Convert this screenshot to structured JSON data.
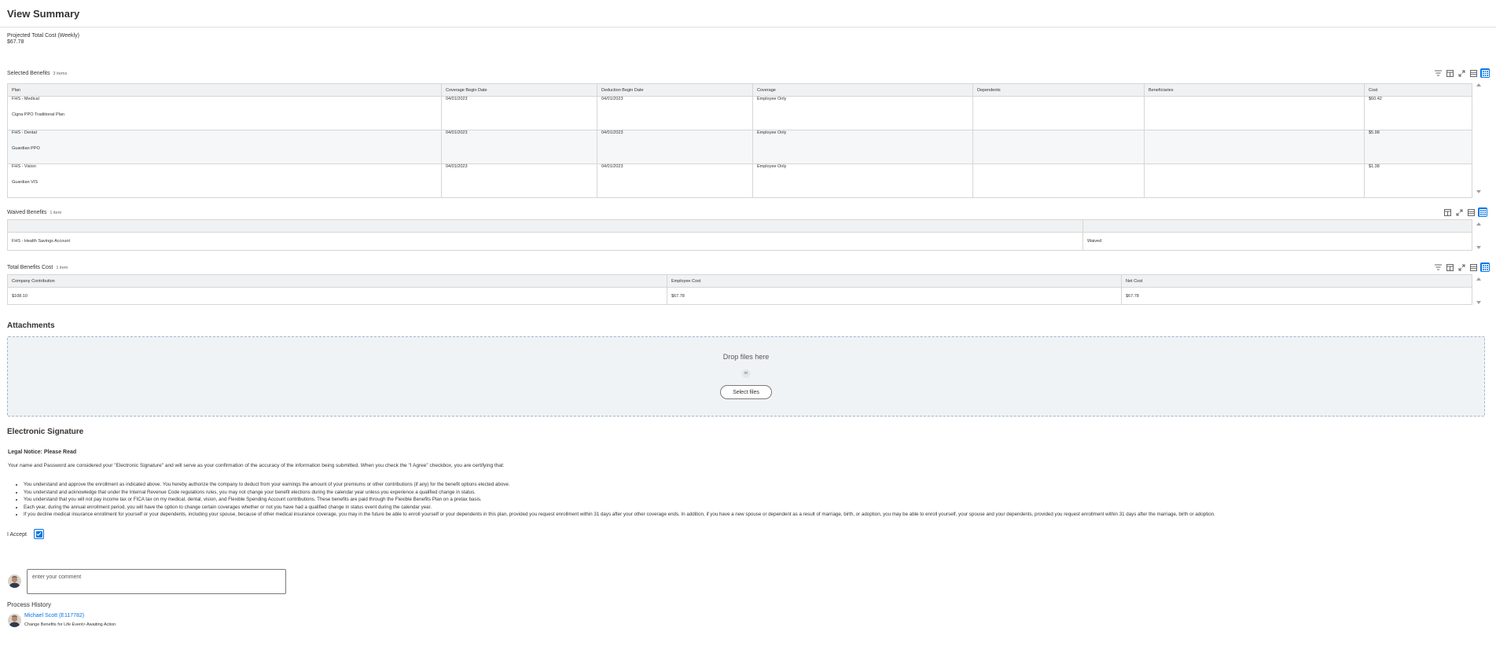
{
  "page": {
    "title": "View Summary"
  },
  "projected": {
    "label": "Projected Total Cost (Weekly)",
    "value": "$67.78"
  },
  "selected_benefits": {
    "title": "Selected Benefits",
    "count": "3 items",
    "columns": [
      "Plan",
      "Coverage Begin Date",
      "Deduction Begin Date",
      "Coverage",
      "Dependents",
      "Beneficiaries",
      "Cost"
    ],
    "rows": [
      {
        "plan": "FHS - Medical",
        "plan_detail": "Cigna PPO Traditional Plan",
        "coverage_begin": "04/01/2023",
        "deduction_begin": "04/01/2023",
        "coverage": "Employee Only",
        "dependents": "",
        "beneficiaries": "",
        "cost": "$60.42"
      },
      {
        "plan": "FHS - Dental",
        "plan_detail": "Guardian PPO",
        "coverage_begin": "04/01/2023",
        "deduction_begin": "04/01/2023",
        "coverage": "Employee Only",
        "dependents": "",
        "beneficiaries": "",
        "cost": "$5.98"
      },
      {
        "plan": "FHS - Vision",
        "plan_detail": "Guardian VIS",
        "coverage_begin": "04/01/2023",
        "deduction_begin": "04/01/2023",
        "coverage": "Employee Only",
        "dependents": "",
        "beneficiaries": "",
        "cost": "$1.38"
      }
    ]
  },
  "waived_benefits": {
    "title": "Waived Benefits",
    "count": "1 item",
    "rows": [
      {
        "plan": "FHS - Health Savings Account",
        "status": "Waived"
      }
    ]
  },
  "total_cost": {
    "title": "Total Benefits Cost",
    "count": "1 item",
    "columns": [
      "Company Contribution",
      "Employee Cost",
      "Net Cost"
    ],
    "row": {
      "company": "$108.10",
      "employee": "$67.78",
      "net": "$67.78"
    }
  },
  "attachments": {
    "title": "Attachments",
    "drop_text": "Drop files here",
    "or_text": "or",
    "select_label": "Select files"
  },
  "esignature": {
    "title": "Electronic Signature",
    "legal_title": "Legal Notice: Please Read",
    "intro": "Your name and Password are considered your \"Electronic Signature\" and will serve as your confirmation of the accuracy of the information being submitted. When you check the \"I Agree\" checkbox, you are certifying that:",
    "items": [
      "You understand and approve the enrollment as indicated above. You hereby authorize the company to deduct from your earnings the amount of your premiums or other contributions (if any) for the benefit options elected above.",
      "You understand and acknowledge that under the Internal Revenue Code regulations rules, you may not change your benefit elections during the calendar year unless you experience a qualified change in status.",
      "You understand that you will not pay income tax or FICA tax on my medical, dental, vision, and Flexible Spending Account contributions. These benefits are paid through the Flexible Benefits Plan on a pretax basis.",
      "Each year, during the annual enrollment period, you will have the option to change certain coverages whether or not you have had a qualified change in status event during the calendar year.",
      "If you decline medical insurance enrollment for yourself or your dependents, including your spouse, because of other medical insurance coverage, you may in the future be able to enroll yourself or your dependents in this plan, provided you request enrollment within 31 days after your other coverage ends. In addition, if you have a new spouse or dependent as a result of marriage, birth, or adoption, you may be able to enroll yourself, your spouse and your dependents, provided you request enrollment within 31 days after the marriage, birth or adoption."
    ],
    "accept_label": "I Accept",
    "accept_checked": true
  },
  "comment": {
    "placeholder": "enter your comment"
  },
  "process_history": {
    "title": "Process History",
    "name": "Michael Scott (E117782)",
    "status": "Change Benefits for Life Event> Awaiting Action"
  },
  "colors": {
    "accent": "#0875e1",
    "header_bg": "#f0f1f2",
    "dropzone_bg": "#f0f3f6"
  }
}
